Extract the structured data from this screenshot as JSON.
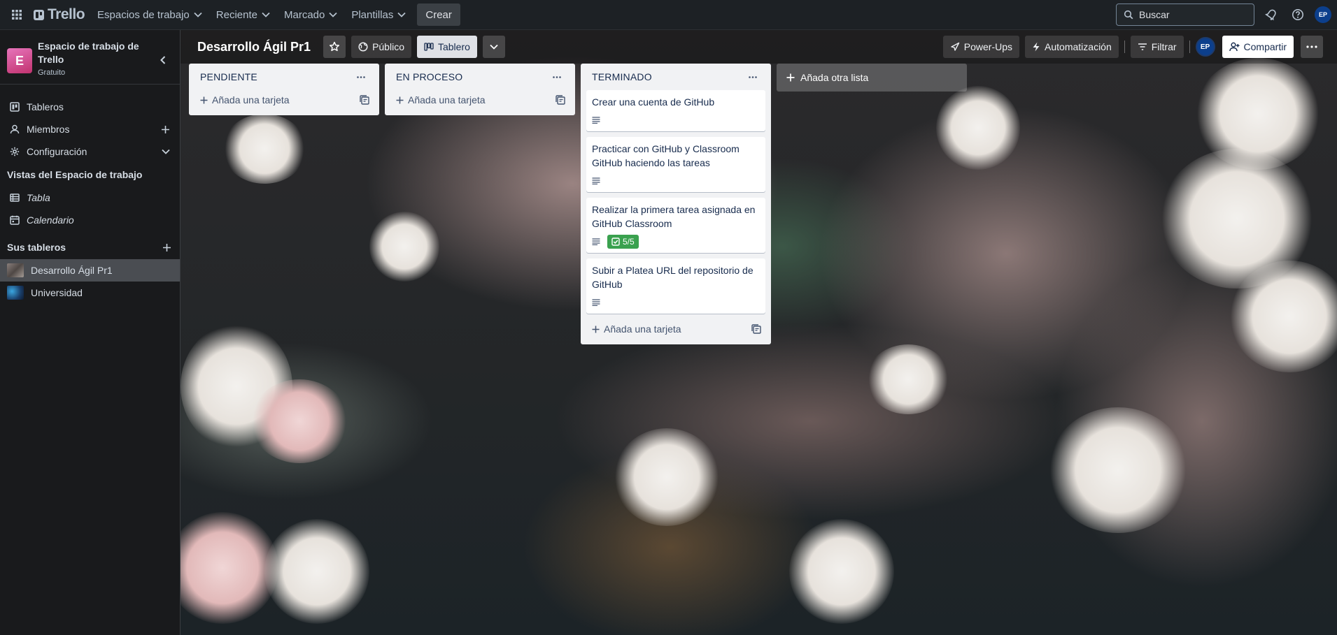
{
  "topbar": {
    "brand": "Trello",
    "menus": [
      "Espacios de trabajo",
      "Reciente",
      "Marcado",
      "Plantillas"
    ],
    "create_label": "Crear",
    "search_placeholder": "Buscar",
    "avatar_initials": "EP"
  },
  "sidebar": {
    "workspace_initial": "E",
    "workspace_name": "Espacio de trabajo de Trello",
    "workspace_plan": "Gratuito",
    "items": [
      {
        "label": "Tableros"
      },
      {
        "label": "Miembros"
      },
      {
        "label": "Configuración"
      }
    ],
    "views_title": "Vistas del Espacio de trabajo",
    "views": [
      {
        "label": "Tabla"
      },
      {
        "label": "Calendario"
      }
    ],
    "boards_title": "Sus tableros",
    "boards": [
      {
        "label": "Desarrollo Ágil Pr1",
        "active": true
      },
      {
        "label": "Universidad",
        "active": false
      }
    ]
  },
  "board": {
    "title": "Desarrollo Ágil Pr1",
    "visibility_label": "Público",
    "view_label": "Tablero",
    "powerups_label": "Power-Ups",
    "automation_label": "Automatización",
    "filter_label": "Filtrar",
    "avatar_initials": "EP",
    "share_label": "Compartir",
    "add_list_label": "Añada otra lista"
  },
  "lists": [
    {
      "title": "PENDIENTE",
      "cards": [],
      "add_card_label": "Añada una tarjeta"
    },
    {
      "title": "EN PROCESO",
      "cards": [],
      "add_card_label": "Añada una tarjeta"
    },
    {
      "title": "TERMINADO",
      "add_card_label": "Añada una tarjeta",
      "cards": [
        {
          "title": "Crear una cuenta de GitHub",
          "has_description": true
        },
        {
          "title": "Practicar con GitHub y Classroom GitHub haciendo las tareas",
          "has_description": true
        },
        {
          "title": "Realizar la primera tarea asignada en GitHub Classroom",
          "has_description": true,
          "checklist": "5/5"
        },
        {
          "title": "Subir a Platea URL del repositorio de GitHub",
          "has_description": true
        }
      ]
    }
  ],
  "colors": {
    "topbar_bg": "#1d2125",
    "sidebar_bg": "#191a1c",
    "list_bg": "#f1f2f4",
    "workspace_logo": "#d6417d",
    "checklist_complete": "#3aa14f",
    "avatar": "#0c3f8c"
  }
}
